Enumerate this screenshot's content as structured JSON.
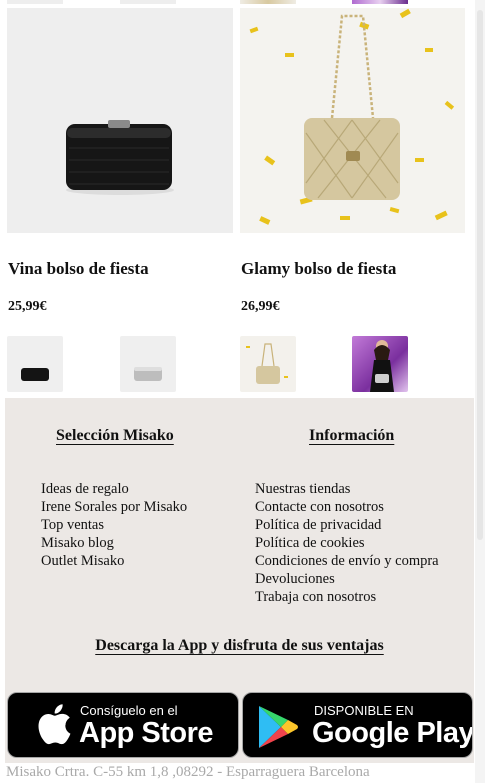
{
  "products": [
    {
      "name": "Vina bolso de fiesta",
      "price": "25,99€"
    },
    {
      "name": "Glamy bolso de fiesta",
      "price": "26,99€"
    }
  ],
  "footer": {
    "col1": {
      "title": "Selección Misako",
      "items": [
        "Ideas de regalo",
        "Irene Sorales por Misako",
        "Top ventas",
        "Misako blog",
        "Outlet Misako"
      ]
    },
    "col2": {
      "title": "Información",
      "items": [
        "Nuestras tiendas",
        "Contacte con nosotros",
        "Política de privacidad",
        "Política de cookies",
        "Condiciones de envío y compra",
        "Devoluciones",
        "Trabaja con nosotros"
      ]
    },
    "app_title": "Descarga la App y disfruta de sus ventajas",
    "appstore": {
      "small": "Consíguelo en el",
      "big": "App Store",
      "icon": "apple-icon"
    },
    "googleplay": {
      "small": "DISPONIBLE EN",
      "big": "Google Play",
      "icon": "google-play-icon"
    },
    "address": "Misako Crtra. C-55 km 1,8 ,08292 - Esparraguera Barcelona"
  },
  "colors": {
    "footer_bg": "#ece8e5",
    "text": "#111111",
    "address": "#a9a9a9"
  }
}
